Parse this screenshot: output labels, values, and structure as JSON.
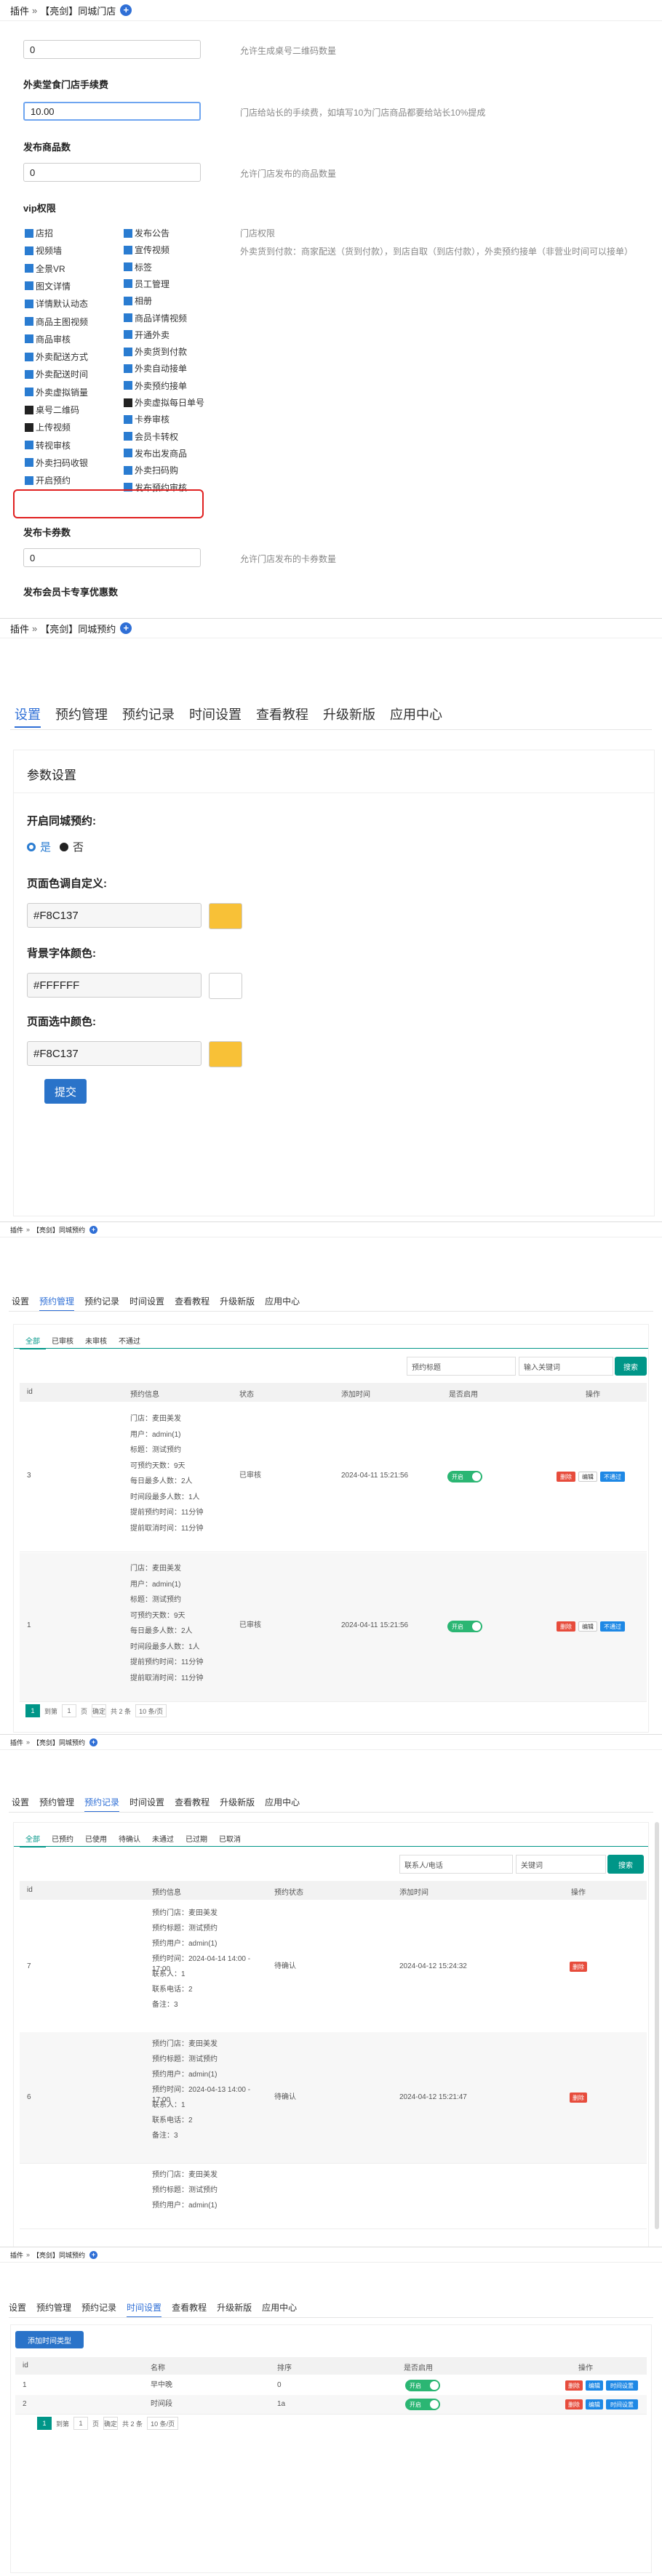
{
  "shot1": {
    "breadcrumb": {
      "plugin": "插件",
      "arrow": "»",
      "name": "【亮剑】同城门店"
    },
    "fields": [
      {
        "label": "",
        "value": "0",
        "hint": "允许生成桌号二维码数量"
      },
      {
        "label": "外卖堂食门店手续费",
        "value": "10.00",
        "hint": "门店给站长的手续费，如填写10为门店商品都要给站长10%提成"
      },
      {
        "label": "发布商品数",
        "value": "0",
        "hint": "允许门店发布的商品数量"
      }
    ],
    "vip_label": "vip权限",
    "vip_col1": [
      "店招",
      "视频墙",
      "全景VR",
      "图文详情",
      "详情默认动态",
      "商品主图视频",
      "商品审核",
      "外卖配送方式",
      "外卖配送时间",
      "外卖虚拟销量",
      "桌号二维码",
      "上传视频",
      "转视审核",
      "外卖扫码收银",
      "开启预约"
    ],
    "vip_col2": [
      "发布公告",
      "宣传视频",
      "标签",
      "员工管理",
      "相册",
      "商品详情视频",
      "开通外卖",
      "外卖货到付款",
      "外卖自动接单",
      "外卖预约接单",
      "外卖虚拟每日单号",
      "卡券审核",
      "会员卡转权",
      "发布出发商品",
      "外卖扫码购",
      "发布预约审核"
    ],
    "vip_hint1": "门店权限",
    "vip_hint2": "外卖货到付款：商家配送（货到付款），到店自取（到店付款），外卖预约接单（非营业时间可以接单）",
    "field4": {
      "label": "发布卡券数",
      "value": "0",
      "hint": "允许门店发布的卡券数量"
    },
    "field5": {
      "label": "发布会员卡专享优惠数"
    }
  },
  "shot2": {
    "breadcrumb": {
      "plugin": "插件",
      "arrow": "»",
      "name": "【亮剑】同城预约"
    },
    "tabs": [
      "设置",
      "预约管理",
      "预约记录",
      "时间设置",
      "查看教程",
      "升级新版",
      "应用中心"
    ],
    "section_title": "参数设置",
    "enable_label": "开启同城预约:",
    "yes": "是",
    "no": "否",
    "color1_label": "页面色调自定义:",
    "color1": "#F8C137",
    "color2_label": "背景字体颜色:",
    "color2": "#FFFFFF",
    "color3_label": "页面选中颜色:",
    "color3": "#F8C137",
    "submit": "提交"
  },
  "shot3": {
    "breadcrumb": {
      "plugin": "插件",
      "arrow": "»",
      "name": "【亮剑】同城预约"
    },
    "tabs": [
      "设置",
      "预约管理",
      "预约记录",
      "时间设置",
      "查看教程",
      "升级新版",
      "应用中心"
    ],
    "subtabs": [
      "全部",
      "已审核",
      "未审核",
      "不通过"
    ],
    "select_placeholder": "预约标题",
    "search_placeholder": "输入关键词",
    "search_btn": "搜索",
    "headers": [
      "id",
      "预约信息",
      "状态",
      "添加时间",
      "是否启用",
      "操作"
    ],
    "rows": [
      {
        "id": "3",
        "info": [
          "门店：麦田美发",
          "用户：admin(1)",
          "标题：测试预约",
          "可预约天数：9天",
          "每日最多人数：2人",
          "时间段最多人数：1人",
          "提前预约时间：11分钟",
          "提前取消时间：11分钟"
        ],
        "status": "已审核",
        "time": "2024-04-11 15:21:56",
        "toggle": "开启",
        "actions": [
          "删除",
          "编辑",
          "不通过"
        ]
      },
      {
        "id": "1",
        "info": [
          "门店：麦田美发",
          "用户：admin(1)",
          "标题：测试预约",
          "可预约天数：9天",
          "每日最多人数：2人",
          "时间段最多人数：1人",
          "提前预约时间：11分钟",
          "提前取消时间：11分钟"
        ],
        "status": "已审核",
        "time": "2024-04-11 15:21:56",
        "toggle": "开启",
        "actions": [
          "删除",
          "编辑",
          "不通过"
        ]
      }
    ],
    "pager": {
      "page": "1",
      "goto": "到第",
      "page_unit": "页",
      "confirm": "确定",
      "total": "共 2 条",
      "per": "10 条/页"
    }
  },
  "shot4": {
    "breadcrumb": {
      "plugin": "插件",
      "arrow": "»",
      "name": "【亮剑】同城预约"
    },
    "tabs": [
      "设置",
      "预约管理",
      "预约记录",
      "时间设置",
      "查看教程",
      "升级新版",
      "应用中心"
    ],
    "subtabs": [
      "全部",
      "已预约",
      "已使用",
      "待确认",
      "未通过",
      "已过期",
      "已取消"
    ],
    "select_placeholder": "联系人/电话",
    "search_placeholder": "关键词",
    "search_btn": "搜索",
    "headers": [
      "id",
      "预约信息",
      "预约状态",
      "添加时间",
      "操作"
    ],
    "rows": [
      {
        "id": "7",
        "info": [
          "预约门店：麦田美发",
          "预约标题：测试预约",
          "预约用户：admin(1)",
          "预约时间：2024-04-14 14:00 - 17:00",
          "联系人：1",
          "联系电话：2",
          "备注：3"
        ],
        "status": "待确认",
        "time": "2024-04-12 15:24:32",
        "action": "删除"
      },
      {
        "id": "6",
        "info": [
          "预约门店：麦田美发",
          "预约标题：测试预约",
          "预约用户：admin(1)",
          "预约时间：2024-04-13 14:00 - 17:00",
          "联系人：1",
          "联系电话：2",
          "备注：3"
        ],
        "status": "待确认",
        "time": "2024-04-12 15:21:47",
        "action": "删除"
      },
      {
        "id": "",
        "info": [
          "预约门店：麦田美发",
          "预约标题：测试预约",
          "预约用户：admin(1)"
        ],
        "status": "",
        "time": "",
        "action": ""
      }
    ]
  },
  "shot5": {
    "breadcrumb": {
      "plugin": "插件",
      "arrow": "»",
      "name": "【亮剑】同城预约"
    },
    "tabs": [
      "设置",
      "预约管理",
      "预约记录",
      "时间设置",
      "查看教程",
      "升级新版",
      "应用中心"
    ],
    "add_btn": "添加时间类型",
    "headers": [
      "id",
      "名称",
      "排序",
      "是否启用",
      "操作"
    ],
    "rows": [
      {
        "id": "1",
        "name": "早中晚",
        "sort": "0",
        "toggle": "开启",
        "actions": [
          "删除",
          "编辑",
          "时间设置"
        ]
      },
      {
        "id": "2",
        "name": "时间段",
        "sort": "1a",
        "toggle": "开启",
        "actions": [
          "删除",
          "编辑",
          "时间设置"
        ]
      }
    ],
    "pager": {
      "page": "1",
      "goto": "到第",
      "page_unit": "页",
      "confirm": "确定",
      "total": "共 2 条",
      "per": "10 条/页"
    }
  },
  "colors": {
    "accent": "#2f6fd6",
    "teal": "#009688",
    "green": "#2bb673",
    "red": "#e74c3c",
    "blue": "#1e88e5",
    "orange": "#F8C137",
    "border_red": "#e02020"
  }
}
